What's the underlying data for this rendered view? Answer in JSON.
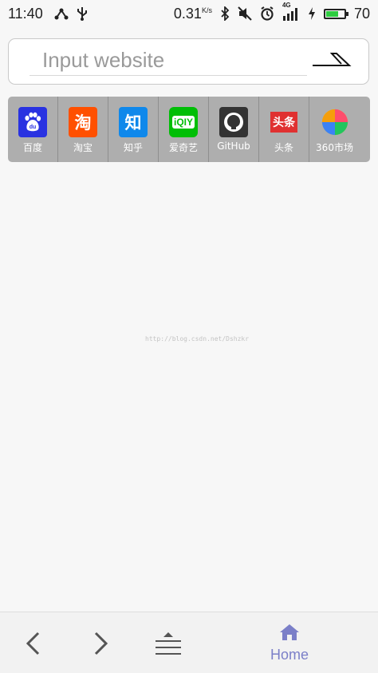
{
  "status_bar": {
    "time": "11:40",
    "net_speed": "0.31",
    "net_unit": "K/s",
    "signal_label": "4G",
    "battery_level": "70",
    "battery_fraction": 0.7,
    "icons": [
      "share-icon",
      "usb-icon",
      "bluetooth-icon",
      "mute-icon",
      "alarm-icon",
      "signal-icon",
      "charging-icon",
      "battery-icon"
    ]
  },
  "search": {
    "placeholder": "Input website",
    "go_icon": "arrow-go-icon"
  },
  "shortcuts": [
    {
      "label": "百度",
      "icon": "baidu-icon",
      "glyph": "du",
      "color": "#2932e1"
    },
    {
      "label": "淘宝",
      "icon": "taobao-icon",
      "glyph": "淘",
      "color": "#ff5000"
    },
    {
      "label": "知乎",
      "icon": "zhihu-icon",
      "glyph": "知",
      "color": "#0f88eb"
    },
    {
      "label": "爱奇艺",
      "icon": "iqiyi-icon",
      "glyph": "iQIY",
      "color": "#00be06"
    },
    {
      "label": "GitHub",
      "icon": "github-icon",
      "glyph": "",
      "color": "#333333"
    },
    {
      "label": "头条",
      "icon": "toutiao-icon",
      "glyph": "头条",
      "color": "#e03131"
    },
    {
      "label": "360市场",
      "icon": "360-market-icon",
      "glyph": "",
      "color": "#ff9900"
    }
  ],
  "watermark": "http://blog.csdn.net/Dshzkr",
  "bottom_nav": {
    "back_icon": "chevron-left-icon",
    "forward_icon": "chevron-right-icon",
    "menu_icon": "menu-icon",
    "home_label": "Home",
    "home_icon": "home-icon",
    "accent": "#7b7fc8"
  }
}
